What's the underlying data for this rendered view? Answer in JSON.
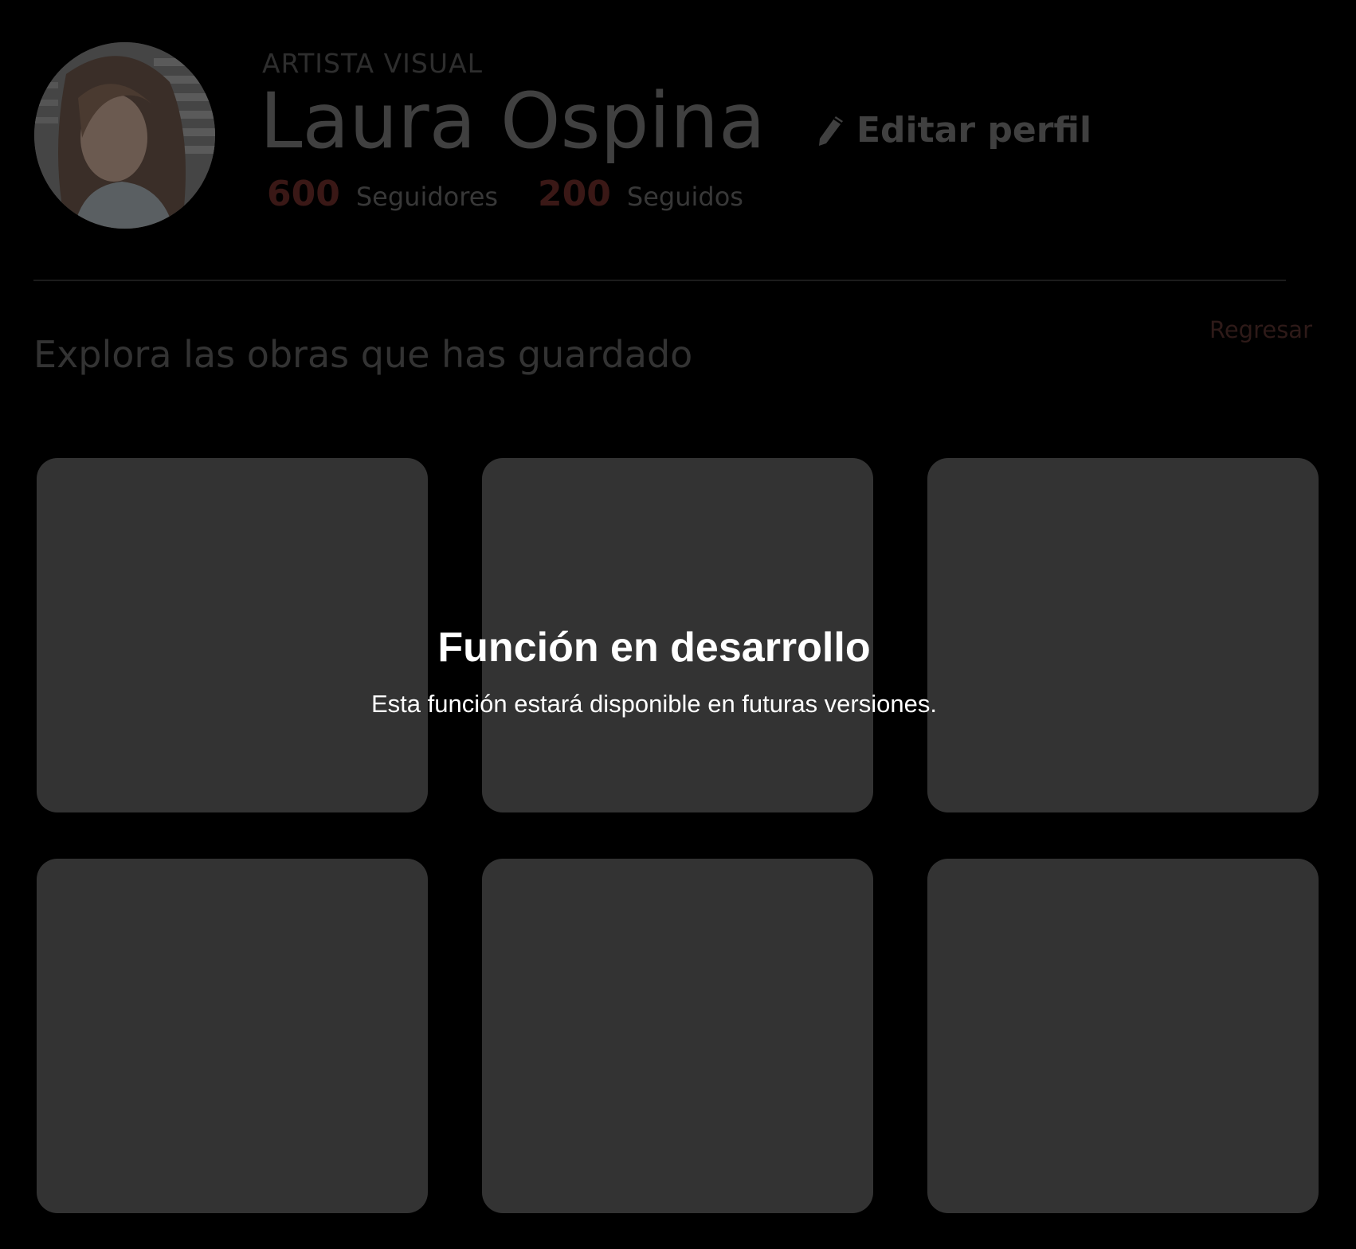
{
  "profile": {
    "role": "ARTISTA VISUAL",
    "name": "Laura Ospina",
    "edit_label": "Editar perfil",
    "followers_count": "600",
    "followers_label": "Seguidores",
    "following_count": "200",
    "following_label": "Seguidos"
  },
  "saved": {
    "title": "Explora las obras que has guardado",
    "back_label": "Regresar"
  },
  "overlay": {
    "title": "Función en desarrollo",
    "message": "Esta función estará disponible en futuras versiones."
  },
  "colors": {
    "background": "#000000",
    "card": "#333333",
    "accent_dim": "#3a1816",
    "text_dim": "#404040",
    "overlay_text": "#ffffff"
  },
  "icons": {
    "edit": "pencil-icon"
  }
}
